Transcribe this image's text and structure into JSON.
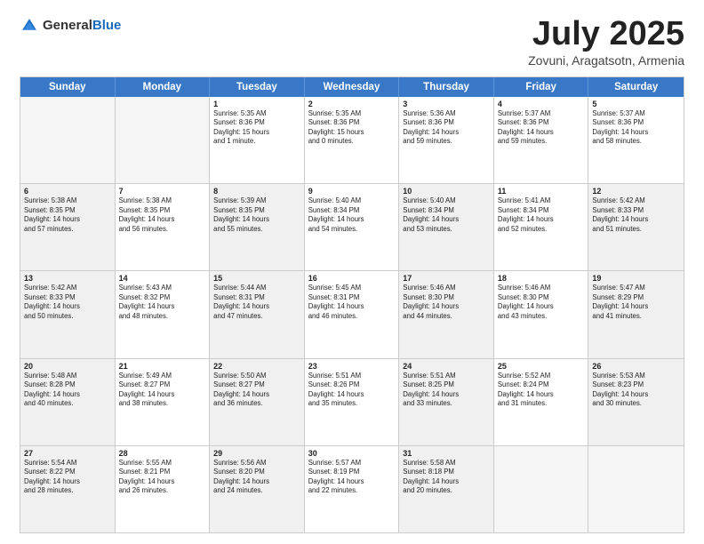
{
  "header": {
    "logo_general": "General",
    "logo_blue": "Blue",
    "month": "July 2025",
    "location": "Zovuni, Aragatsotn, Armenia"
  },
  "weekdays": [
    "Sunday",
    "Monday",
    "Tuesday",
    "Wednesday",
    "Thursday",
    "Friday",
    "Saturday"
  ],
  "rows": [
    [
      {
        "day": "",
        "info": "",
        "empty": true
      },
      {
        "day": "",
        "info": "",
        "empty": true
      },
      {
        "day": "1",
        "info": "Sunrise: 5:35 AM\nSunset: 8:36 PM\nDaylight: 15 hours\nand 1 minute."
      },
      {
        "day": "2",
        "info": "Sunrise: 5:35 AM\nSunset: 8:36 PM\nDaylight: 15 hours\nand 0 minutes."
      },
      {
        "day": "3",
        "info": "Sunrise: 5:36 AM\nSunset: 8:36 PM\nDaylight: 14 hours\nand 59 minutes."
      },
      {
        "day": "4",
        "info": "Sunrise: 5:37 AM\nSunset: 8:36 PM\nDaylight: 14 hours\nand 59 minutes."
      },
      {
        "day": "5",
        "info": "Sunrise: 5:37 AM\nSunset: 8:36 PM\nDaylight: 14 hours\nand 58 minutes."
      }
    ],
    [
      {
        "day": "6",
        "info": "Sunrise: 5:38 AM\nSunset: 8:35 PM\nDaylight: 14 hours\nand 57 minutes.",
        "shaded": true
      },
      {
        "day": "7",
        "info": "Sunrise: 5:38 AM\nSunset: 8:35 PM\nDaylight: 14 hours\nand 56 minutes."
      },
      {
        "day": "8",
        "info": "Sunrise: 5:39 AM\nSunset: 8:35 PM\nDaylight: 14 hours\nand 55 minutes.",
        "shaded": true
      },
      {
        "day": "9",
        "info": "Sunrise: 5:40 AM\nSunset: 8:34 PM\nDaylight: 14 hours\nand 54 minutes."
      },
      {
        "day": "10",
        "info": "Sunrise: 5:40 AM\nSunset: 8:34 PM\nDaylight: 14 hours\nand 53 minutes.",
        "shaded": true
      },
      {
        "day": "11",
        "info": "Sunrise: 5:41 AM\nSunset: 8:34 PM\nDaylight: 14 hours\nand 52 minutes."
      },
      {
        "day": "12",
        "info": "Sunrise: 5:42 AM\nSunset: 8:33 PM\nDaylight: 14 hours\nand 51 minutes.",
        "shaded": true
      }
    ],
    [
      {
        "day": "13",
        "info": "Sunrise: 5:42 AM\nSunset: 8:33 PM\nDaylight: 14 hours\nand 50 minutes.",
        "shaded": true
      },
      {
        "day": "14",
        "info": "Sunrise: 5:43 AM\nSunset: 8:32 PM\nDaylight: 14 hours\nand 48 minutes."
      },
      {
        "day": "15",
        "info": "Sunrise: 5:44 AM\nSunset: 8:31 PM\nDaylight: 14 hours\nand 47 minutes.",
        "shaded": true
      },
      {
        "day": "16",
        "info": "Sunrise: 5:45 AM\nSunset: 8:31 PM\nDaylight: 14 hours\nand 46 minutes."
      },
      {
        "day": "17",
        "info": "Sunrise: 5:46 AM\nSunset: 8:30 PM\nDaylight: 14 hours\nand 44 minutes.",
        "shaded": true
      },
      {
        "day": "18",
        "info": "Sunrise: 5:46 AM\nSunset: 8:30 PM\nDaylight: 14 hours\nand 43 minutes."
      },
      {
        "day": "19",
        "info": "Sunrise: 5:47 AM\nSunset: 8:29 PM\nDaylight: 14 hours\nand 41 minutes.",
        "shaded": true
      }
    ],
    [
      {
        "day": "20",
        "info": "Sunrise: 5:48 AM\nSunset: 8:28 PM\nDaylight: 14 hours\nand 40 minutes.",
        "shaded": true
      },
      {
        "day": "21",
        "info": "Sunrise: 5:49 AM\nSunset: 8:27 PM\nDaylight: 14 hours\nand 38 minutes."
      },
      {
        "day": "22",
        "info": "Sunrise: 5:50 AM\nSunset: 8:27 PM\nDaylight: 14 hours\nand 36 minutes.",
        "shaded": true
      },
      {
        "day": "23",
        "info": "Sunrise: 5:51 AM\nSunset: 8:26 PM\nDaylight: 14 hours\nand 35 minutes."
      },
      {
        "day": "24",
        "info": "Sunrise: 5:51 AM\nSunset: 8:25 PM\nDaylight: 14 hours\nand 33 minutes.",
        "shaded": true
      },
      {
        "day": "25",
        "info": "Sunrise: 5:52 AM\nSunset: 8:24 PM\nDaylight: 14 hours\nand 31 minutes."
      },
      {
        "day": "26",
        "info": "Sunrise: 5:53 AM\nSunset: 8:23 PM\nDaylight: 14 hours\nand 30 minutes.",
        "shaded": true
      }
    ],
    [
      {
        "day": "27",
        "info": "Sunrise: 5:54 AM\nSunset: 8:22 PM\nDaylight: 14 hours\nand 28 minutes.",
        "shaded": true
      },
      {
        "day": "28",
        "info": "Sunrise: 5:55 AM\nSunset: 8:21 PM\nDaylight: 14 hours\nand 26 minutes."
      },
      {
        "day": "29",
        "info": "Sunrise: 5:56 AM\nSunset: 8:20 PM\nDaylight: 14 hours\nand 24 minutes.",
        "shaded": true
      },
      {
        "day": "30",
        "info": "Sunrise: 5:57 AM\nSunset: 8:19 PM\nDaylight: 14 hours\nand 22 minutes."
      },
      {
        "day": "31",
        "info": "Sunrise: 5:58 AM\nSunset: 8:18 PM\nDaylight: 14 hours\nand 20 minutes.",
        "shaded": true
      },
      {
        "day": "",
        "info": "",
        "empty": true
      },
      {
        "day": "",
        "info": "",
        "empty": true
      }
    ]
  ]
}
